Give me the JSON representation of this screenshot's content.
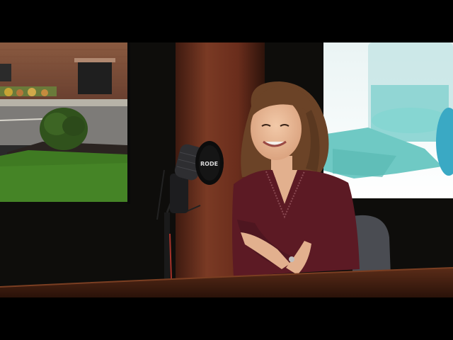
{
  "video": {
    "microphone_brand_fragment": "RODE",
    "colors": {
      "backdrop": "#0e0d0b",
      "column": "#6a2d1c",
      "desk": "#3a1a0f",
      "sweater": "#5c1a24",
      "monitor_left_grass": "#3f7a22",
      "monitor_right_towel": "#6fc9c4"
    },
    "icons": [
      "microphone-icon"
    ]
  }
}
